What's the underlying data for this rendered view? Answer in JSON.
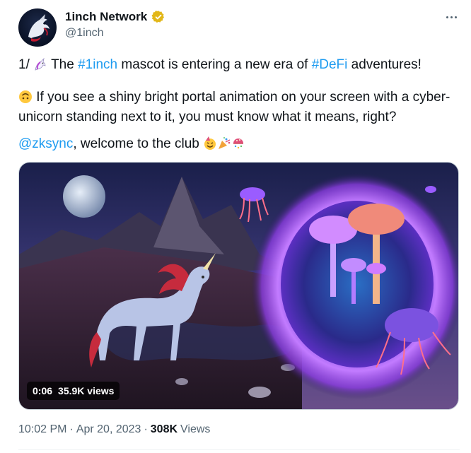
{
  "author": {
    "name": "1inch Network",
    "handle": "@1inch",
    "verified": true,
    "verified_color": "#e2b719"
  },
  "tweet": {
    "line1": {
      "prefix": "1/",
      "text_a": "The",
      "hashtag1": "#1inch",
      "text_b": "mascot is entering a new era of",
      "hashtag2": "#DeFi",
      "text_c": "adventures!"
    },
    "line2": "If you see a shiny bright portal animation on your screen with a cyber-unicorn standing next to it, you must know what it means, right?",
    "line3": {
      "mention": "@zksync",
      "text": ", welcome to the club"
    }
  },
  "media": {
    "time": "0:06",
    "views": "35.9K views"
  },
  "meta": {
    "time": "10:02 PM",
    "sep1": "·",
    "date": "Apr 20, 2023",
    "sep2": "·",
    "views_count": "308K",
    "views_label": "Views"
  },
  "colors": {
    "link": "#1d9bf0",
    "text": "#0f1419",
    "secondary": "#536471"
  },
  "icons": [
    "unicorn-icon",
    "upside-down-face-icon",
    "party-face-icon",
    "party-popper-icon",
    "confetti-ball-icon",
    "verified-badge-icon",
    "more-icon"
  ]
}
